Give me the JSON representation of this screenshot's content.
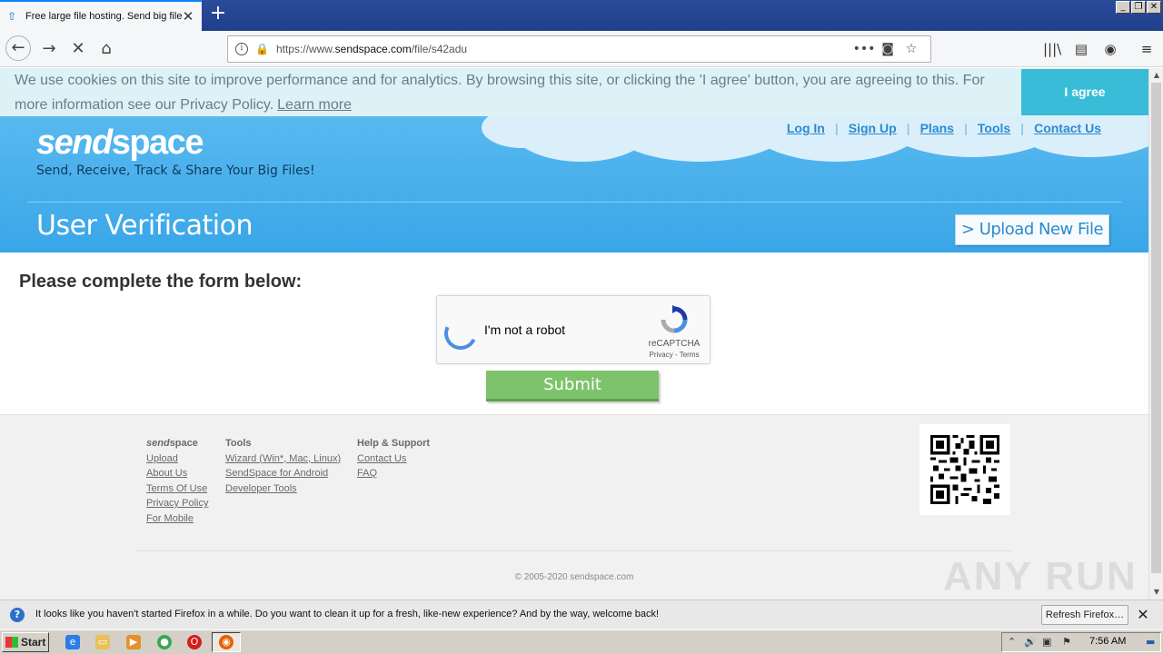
{
  "browser": {
    "tab_title": "Free large file hosting. Send big files",
    "new_tab": "+",
    "url_prefix": "https://www.",
    "url_domain": "sendspace.com",
    "url_path": "/file/s42adu"
  },
  "cookie": {
    "message": "We use cookies on this site to improve performance and for analytics. By browsing this site, or clicking the 'I agree' button, you are agreeing to this. For more information see our Privacy Policy.",
    "learn_more": "Learn more",
    "agree": "I agree"
  },
  "header": {
    "logo_send": "send",
    "logo_space": "space",
    "tagline": "Send, Receive, Track & Share Your Big Files!",
    "links": [
      "Log In",
      "Sign Up",
      "Plans",
      "Tools",
      "Contact Us"
    ],
    "page_title": "User Verification",
    "upload_button": "> Upload New File"
  },
  "form": {
    "heading": "Please complete the form below:",
    "captcha_label": "I'm not a robot",
    "captcha_brand": "reCAPTCHA",
    "captcha_terms": "Privacy - Terms",
    "submit": "Submit"
  },
  "footer": {
    "col1_head_italic": "send",
    "col1_head_rest": "space",
    "col1_links": [
      "Upload",
      "About Us",
      "Terms Of Use",
      "Privacy Policy",
      "For Mobile"
    ],
    "col2_head": "Tools",
    "col2_links": [
      "Wizard (Win*, Mac, Linux)",
      "SendSpace for Android",
      "Developer Tools"
    ],
    "col3_head": "Help & Support",
    "col3_links": [
      "Contact Us",
      "FAQ"
    ],
    "copyright": "© 2005-2020 sendspace.com"
  },
  "watermark": "ANY RUN",
  "notification": {
    "text": "It looks like you haven't started Firefox in a while. Do you want to clean it up for a fresh, like-new experience? And by the way, welcome back!",
    "button": "Refresh Firefox…"
  },
  "taskbar": {
    "start": "Start",
    "clock": "7:56 AM"
  },
  "colors": {
    "hero_blue": "#3aa6e8",
    "link_blue": "#2a8bd1",
    "cookie_bg": "#ddf2f7",
    "agree_bg": "#38bcd8",
    "submit_green": "#7dc36b"
  }
}
